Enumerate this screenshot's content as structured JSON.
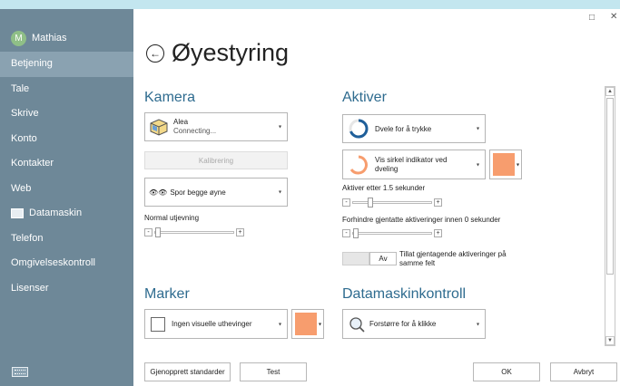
{
  "sidebar": {
    "user": {
      "initial": "M",
      "name": "Mathias"
    },
    "items": [
      {
        "label": "Betjening"
      },
      {
        "label": "Tale"
      },
      {
        "label": "Skrive"
      },
      {
        "label": "Konto"
      },
      {
        "label": "Kontakter"
      },
      {
        "label": "Web"
      },
      {
        "label": "Datamaskin"
      },
      {
        "label": "Telefon"
      },
      {
        "label": "Omgivelseskontroll"
      },
      {
        "label": "Lisenser"
      }
    ]
  },
  "page": {
    "title": "Øyestyring"
  },
  "kamera": {
    "title": "Kamera",
    "device_name": "Alea",
    "device_status": "Connecting...",
    "calibrate_label": "Kalibrering",
    "eye_mode": "Spor begge øyne",
    "smoothing_label": "Normal utjevning"
  },
  "aktiver": {
    "title": "Aktiver",
    "mode": "Dvele for å trykke",
    "indicator": "Vis sirkel indikator ved dveling",
    "indicator_color": "#f79d6e",
    "activate_after": "Aktiver etter 1.5 sekunder",
    "prevent_repeat": "Forhindre gjentatte aktiveringer innen 0 sekunder",
    "allow_repeat_label": "Tillat gjentagende aktiveringer på samme felt",
    "allow_repeat_state": "Av"
  },
  "marker": {
    "title": "Marker",
    "style": "Ingen visuelle uthevinger",
    "color": "#f79d6e"
  },
  "datamaskinkontroll": {
    "title": "Datamaskinkontroll",
    "mode": "Forstørre for å klikke"
  },
  "footer": {
    "reset_label": "Gjenopprett standarder",
    "test_label": "Test",
    "ok_label": "OK",
    "cancel_label": "Avbryt"
  },
  "window": {
    "maximize": "□",
    "close": "✕"
  },
  "colors": {
    "sidebar": "#6e8898",
    "sidebar_active": "#8aa2b1",
    "accent": "#2e6b8f",
    "ring": "#1f5f9a"
  }
}
